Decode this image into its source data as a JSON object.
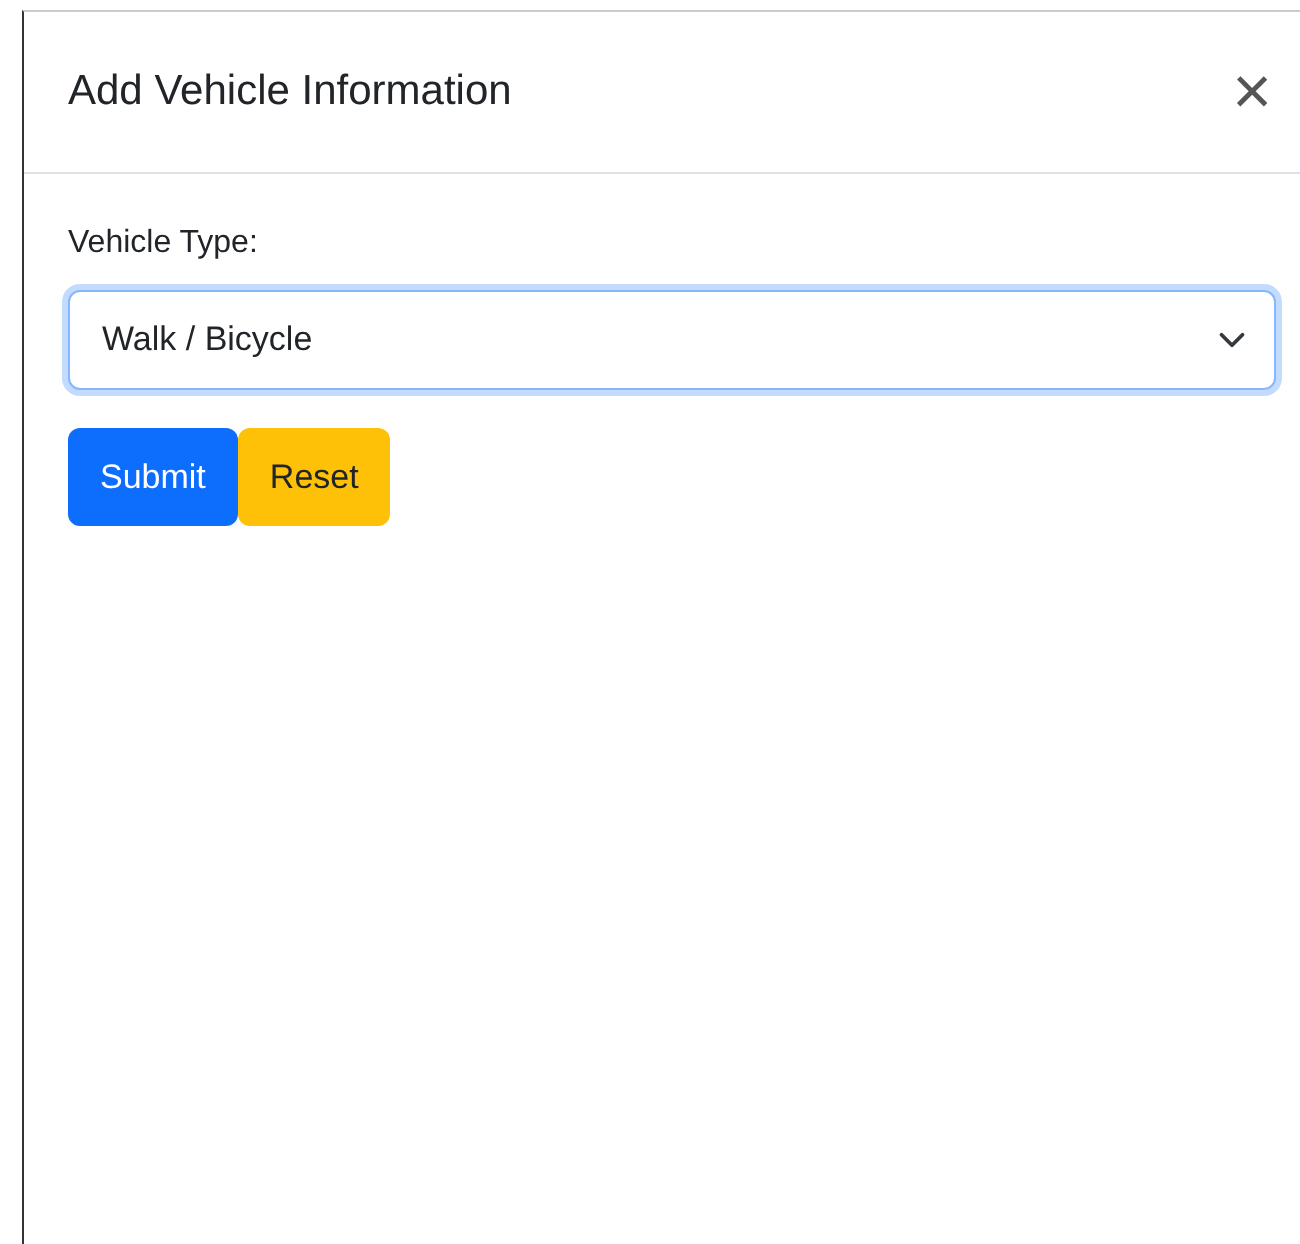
{
  "dialog": {
    "title": "Add Vehicle Information",
    "close_icon": "×"
  },
  "form": {
    "label": "Vehicle Type:",
    "select": {
      "value": "Walk / Bicycle",
      "focused": true
    }
  },
  "buttons": [
    {
      "label": "Submit",
      "kind": "primary"
    },
    {
      "label": "Reset",
      "kind": "warning"
    }
  ]
}
